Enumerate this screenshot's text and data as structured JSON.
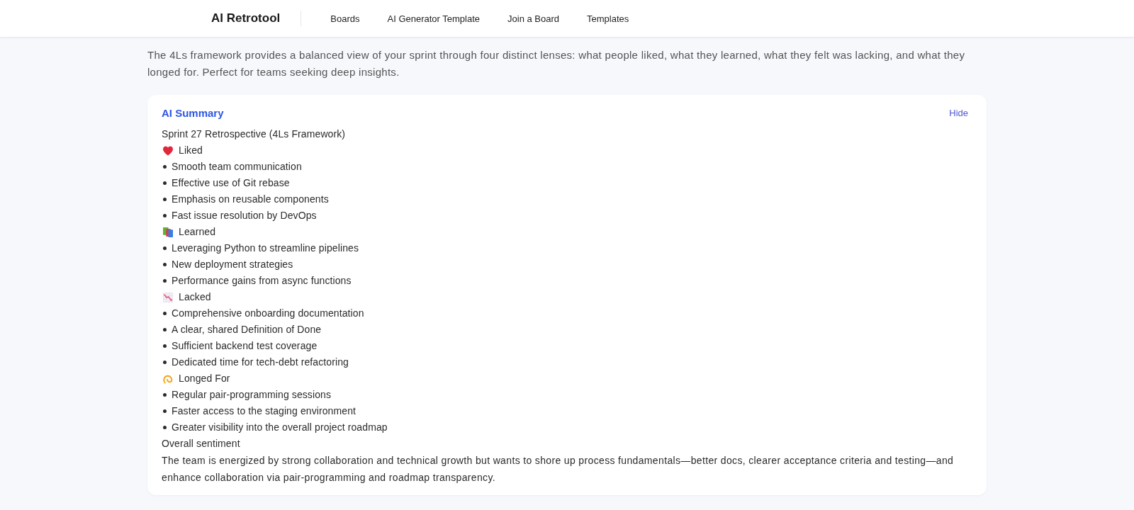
{
  "header": {
    "logo": "AI Retrotool",
    "nav": [
      "Boards",
      "AI Generator Template",
      "Join a Board",
      "Templates"
    ]
  },
  "description": "The 4Ls framework provides a balanced view of your sprint through four distinct lenses: what people liked, what they learned, what they felt was lacking, and what they longed for. Perfect for teams seeking deep insights.",
  "summary": {
    "title": "AI Summary",
    "hide_link": "Hide",
    "heading": "Sprint 27 Retrospective (4Ls Framework)",
    "sections": [
      {
        "title": "Liked",
        "items": [
          "Smooth team communication",
          "Effective use of Git rebase",
          "Emphasis on reusable components",
          "Fast issue resolution by DevOps"
        ]
      },
      {
        "title": "Learned",
        "items": [
          "Leveraging Python to streamline pipelines",
          "New deployment strategies",
          "Performance gains from async functions"
        ]
      },
      {
        "title": "Lacked",
        "items": [
          "Comprehensive onboarding documentation",
          "A clear, shared Definition of Done",
          "Sufficient backend test coverage",
          "Dedicated time for tech-debt refactoring"
        ]
      },
      {
        "title": "Longed For",
        "items": [
          "Regular pair-programming sessions",
          "Faster access to the staging environment",
          "Greater visibility into the overall project roadmap"
        ]
      }
    ],
    "sentiment_heading": "Overall sentiment",
    "sentiment": "The team is energized by strong collaboration and technical growth but wants to shore up process fundamentals—better docs, clearer acceptance criteria and testing—and enhance collaboration via pair-programming and roadmap transparency."
  }
}
